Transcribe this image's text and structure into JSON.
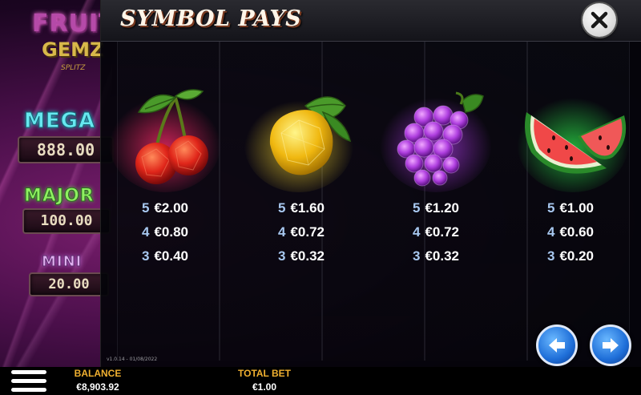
{
  "game": {
    "logo_line1": "FRUIT",
    "logo_line2": "GEMZ",
    "logo_line3": "SPLITZ"
  },
  "jackpots": {
    "mega": {
      "label": "MEGA",
      "value": "888.00"
    },
    "major": {
      "label": "MAJOR",
      "value": "100.00"
    },
    "mini": {
      "label": "MINI",
      "value": "20.00"
    }
  },
  "paytable": {
    "title": "SYMBOL PAYS",
    "symbols": [
      {
        "name": "cherry",
        "pays": [
          {
            "count": "5",
            "amount": "€2.00"
          },
          {
            "count": "4",
            "amount": "€0.80"
          },
          {
            "count": "3",
            "amount": "€0.40"
          }
        ]
      },
      {
        "name": "lemon",
        "pays": [
          {
            "count": "5",
            "amount": "€1.60"
          },
          {
            "count": "4",
            "amount": "€0.72"
          },
          {
            "count": "3",
            "amount": "€0.32"
          }
        ]
      },
      {
        "name": "grapes",
        "pays": [
          {
            "count": "5",
            "amount": "€1.20"
          },
          {
            "count": "4",
            "amount": "€0.72"
          },
          {
            "count": "3",
            "amount": "€0.32"
          }
        ]
      },
      {
        "name": "watermelon",
        "pays": [
          {
            "count": "5",
            "amount": "€1.00"
          },
          {
            "count": "4",
            "amount": "€0.60"
          },
          {
            "count": "3",
            "amount": "€0.20"
          }
        ]
      }
    ],
    "version": "v1.0.14 - 01/08/2022",
    "icons": {
      "close": "close-icon",
      "prev": "arrow-left-icon",
      "next": "arrow-right-icon"
    }
  },
  "bottom_bar": {
    "balance_label": "BALANCE",
    "balance_value": "€8,903.92",
    "total_bet_label": "TOTAL BET",
    "total_bet_value": "€1.00",
    "menu_icon": "hamburger-menu-icon"
  },
  "colors": {
    "overlay_bg": "#04040a",
    "title_text": "#fff5e8",
    "pay_count": "#a8c8f0",
    "bottom_label": "#f0b030",
    "nav_button": "#1e6ed8"
  }
}
